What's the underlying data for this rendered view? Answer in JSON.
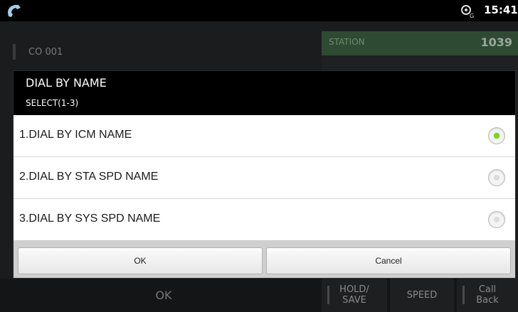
{
  "status_bar": {
    "time": "15:41",
    "left_icon": "phone-handset-icon",
    "right_icon": "sync-gear-icon"
  },
  "background": {
    "line_label": "CO 001",
    "station_label": "STATION",
    "station_number": "1039",
    "softkeys": {
      "ok": "OK",
      "hold_save": "HOLD/\nSAVE",
      "speed": "SPEED",
      "call_back": "Call\nBack"
    }
  },
  "dialog": {
    "title": "DIAL BY NAME",
    "subtitle": "SELECT(1-3)",
    "options": [
      {
        "label": "1.DIAL BY ICM NAME",
        "selected": true
      },
      {
        "label": "2.DIAL BY STA SPD NAME",
        "selected": false
      },
      {
        "label": "3.DIAL BY SYS SPD NAME",
        "selected": false
      }
    ],
    "ok_label": "OK",
    "cancel_label": "Cancel"
  },
  "colors": {
    "radio_selected": "#7ed321",
    "station_bg": "#2f4a33"
  }
}
